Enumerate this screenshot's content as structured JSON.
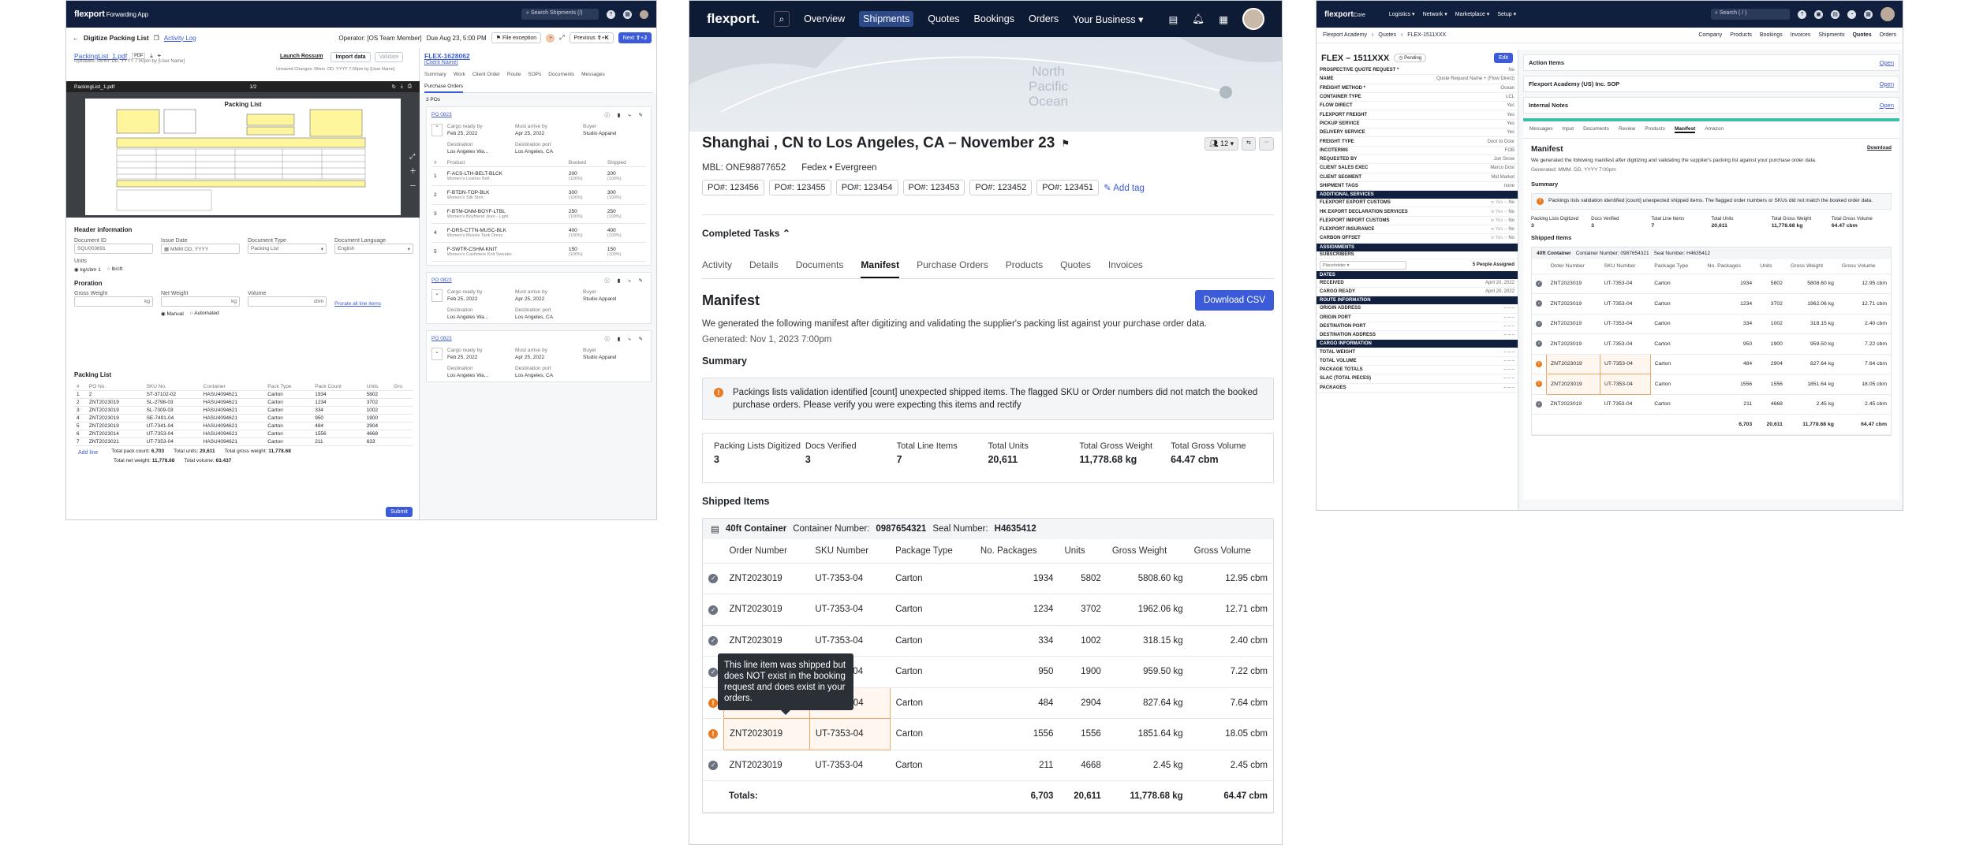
{
  "left": {
    "brand": "flexport",
    "brand_sub": "Forwarding App",
    "search": "Search Shipments (/)",
    "title": "Digitize Packing List",
    "activity_log": "Activity Log",
    "operator": "Operator: [OS Team Member]",
    "due": "Due Aug 23, 5:00 PM",
    "file_exception": "File exception",
    "previous": "Previous",
    "prev_key": "⇧",
    "prev_key2": "K",
    "next": "Next",
    "next_key": "⇧",
    "next_key2": "J",
    "file_name": "PackingList_1.pdf",
    "file_tag": "PDF",
    "launch": "Launch Rossum",
    "import": "Import data",
    "validate": "Validate",
    "uploaded": "Uploaded: Mmm. DD, YYYY 7:00pm by [User Name]",
    "unsaved": "Unsaved Changes: Mmm. DD, YYYY 7:00pm by [User Name]",
    "pdf_name": "PackingList_1.pdf",
    "pdf_pages": "1/2",
    "doc_heading": "Packing List",
    "header_info": "Header information",
    "doc_id_label": "Document ID",
    "doc_id": "SQU003691",
    "issue_date_label": "Issue Date",
    "issue_date": "MMM DD, YYYY",
    "doc_type_label": "Document Type",
    "doc_type": "Packing List",
    "doc_lang_label": "Document Language",
    "doc_lang": "English",
    "units_label": "Units",
    "unit1": "kg/cbm 1",
    "unit2": "lb/cft",
    "proration": "Proration",
    "gross_label": "Gross Weight",
    "gross_unit": "kg",
    "net_label": "Net Weight",
    "net_unit": "kg",
    "vol_label": "Volume",
    "vol_unit": "cbm",
    "prorate": "Prorate all line items",
    "manual": "Manual",
    "automated": "Automated",
    "packing_list": "Packing List",
    "pl_cols": [
      "#",
      "PO No.",
      "SKU No.",
      "Container",
      "Pack Type",
      "Pack Count",
      "Units",
      "Gro"
    ],
    "pl_rows": [
      [
        "1",
        "2",
        "ST-37102-02",
        "HASU4094621",
        "Carton",
        "1934",
        "5802"
      ],
      [
        "2",
        "ZNT2023019",
        "SL-2798-03",
        "HASU4094621",
        "Carton",
        "1234",
        "3702"
      ],
      [
        "3",
        "ZNT2023019",
        "SL-7309-03",
        "HASU4094621",
        "Carton",
        "334",
        "1002"
      ],
      [
        "4",
        "ZNT2023019",
        "SE-7491-04",
        "HASU4094621",
        "Carton",
        "950",
        "1900"
      ],
      [
        "5",
        "ZNT2023019",
        "UT-7341-04",
        "HASU4094621",
        "Carton",
        "484",
        "2904"
      ],
      [
        "6",
        "ZNT2023014",
        "UT-7353-04",
        "HASU4094621",
        "Carton",
        "1556",
        "4668"
      ],
      [
        "7",
        "ZNT2023021",
        "UT-7353-04",
        "HASU4094621",
        "Carton",
        "211",
        "633"
      ]
    ],
    "add_line": "Add line",
    "total_pack": "Total pack count:",
    "total_pack_v": "6,703",
    "total_units": "Total units:",
    "total_units_v": "20,611",
    "total_gross": "Total gross weight:",
    "total_gross_v": "11,778.68",
    "total_net": "Total net weight:",
    "total_net_v": "11,778.68",
    "total_vol": "Total volume:",
    "total_vol_v": "63.437",
    "submit": "Submit",
    "flex_id": "FLEX-1628062",
    "client_name": "[Client Name]",
    "rtabs": [
      "Summary",
      "Work",
      "Client Order",
      "Route",
      "SOPs",
      "Documents",
      "Messages"
    ],
    "rsub": "Purchase Orders",
    "po_count": "3 POs",
    "po1": "PO 0823",
    "po2": "PO 0823",
    "po3": "PO 0823",
    "cargo_ready": "Cargo ready by",
    "must_arrive": "Must arrive by",
    "buyer": "Buyer",
    "cargo_date": "Feb 25, 2022",
    "arrive_date": "Apr 25, 2022",
    "buyer_name": "Studio Apparel",
    "destination": "Destination",
    "dest_port": "Destination port",
    "dest_val": "Los Angeles Wa...",
    "port_val": "Los Angeles, CA",
    "po_cols": [
      "#",
      "Product",
      "Booked",
      "Shipped"
    ],
    "po_items": [
      [
        "1",
        "F-ACS-LTH-BELT-BLCK",
        "Women's Leather Belt",
        "200",
        "200"
      ],
      [
        "2",
        "F-BTDN-TOP-BLK",
        "Women's Silk Shirt",
        "300",
        "300"
      ],
      [
        "3",
        "F-BTM-DNM-BOYF-LTBL",
        "Women's Boyfriend Jean - Light",
        "250",
        "250"
      ],
      [
        "4",
        "F-DRS-CTTN-MUSC-BLK",
        "Women's Muscle Tank Dress",
        "400",
        "400"
      ],
      [
        "5",
        "F-SWTR-CSHM-KNIT",
        "Women's Cashmere Knit Sweater",
        "150",
        "150"
      ]
    ],
    "pct": "(100%)"
  },
  "mid": {
    "brand": "flexport.",
    "nav": [
      "Overview",
      "Shipments",
      "Quotes",
      "Bookings",
      "Orders",
      "Your Business"
    ],
    "map_labels": [
      "North",
      "Pacific",
      "Ocean"
    ],
    "title": "Shanghai , CN to Los Angeles, CA – November 23",
    "mbl": "MBL: ONE98877652",
    "carrier": "Fedex • Evergreen",
    "pos": [
      "PO#: 123456",
      "PO#: 123455",
      "PO#: 123454",
      "PO#: 123453",
      "PO#: 123452",
      "PO#: 123451"
    ],
    "add_tag": "Add tag",
    "tasks": "Completed Tasks",
    "tabs": [
      "Activity",
      "Details",
      "Documents",
      "Manifest",
      "Purchase Orders",
      "Products",
      "Quotes",
      "Invoices"
    ],
    "manifest": "Manifest",
    "download": "Download CSV",
    "desc": "We generated the following manifest after digitizing and validating the supplier's packing list against your purchase order data.",
    "generated": "Generated: Nov 1, 2023 7:00pm",
    "summary": "Summary",
    "alert": "Packings lists validation identified [count] unexpected shipped items. The flagged SKU or Order numbers did not match the booked purchase orders. Please verify you were expecting this items and rectify",
    "stats": [
      {
        "label": "Packing Lists Digitized",
        "value": "3"
      },
      {
        "label": "Docs Verified",
        "value": "3"
      },
      {
        "label": "Total Line Items",
        "value": "7"
      },
      {
        "label": "Total Units",
        "value": "20,611"
      },
      {
        "label": "Total Gross Weight",
        "value": "11,778.68 kg"
      },
      {
        "label": "Total Gross Volume",
        "value": "64.47 cbm"
      }
    ],
    "shipped": "Shipped Items",
    "container": "40ft Container",
    "container_no_label": "Container Number:",
    "container_no": "0987654321",
    "seal_label": "Seal Number:",
    "seal": "H4635412",
    "cols": [
      "Order Number",
      "SKU Number",
      "Package Type",
      "No. Packages",
      "Units",
      "Gross Weight",
      "Gross Volume"
    ],
    "rows": [
      [
        "ok",
        "ZNT2023019",
        "UT-7353-04",
        "Carton",
        "1934",
        "5802",
        "5808.60 kg",
        "12.95 cbm"
      ],
      [
        "ok",
        "ZNT2023019",
        "UT-7353-04",
        "Carton",
        "1234",
        "3702",
        "1962.06 kg",
        "12.71 cbm"
      ],
      [
        "ok",
        "ZNT2023019",
        "UT-7353-04",
        "Carton",
        "334",
        "1002",
        "318.15 kg",
        "2.40 cbm"
      ],
      [
        "ok",
        "ZNT2023019",
        "UT-7353-04",
        "Carton",
        "950",
        "1900",
        "959.50 kg",
        "7.22 cbm"
      ],
      [
        "warn",
        "ZNT2023019",
        "UT-7353-04",
        "Carton",
        "484",
        "2904",
        "827.64 kg",
        "7.64 cbm"
      ],
      [
        "warn",
        "ZNT2023019",
        "UT-7353-04",
        "Carton",
        "1556",
        "1556",
        "1851.64 kg",
        "18.05 cbm"
      ],
      [
        "ok",
        "ZNT2023019",
        "UT-7353-04",
        "Carton",
        "211",
        "4668",
        "2.45 kg",
        "2.45 cbm"
      ]
    ],
    "totals": "Totals:",
    "tot_pk": "6,703",
    "tot_units": "20,611",
    "tot_gw": "11,778.68 kg",
    "tot_gv": "64.47 cbm",
    "tooltip": "This line item was shipped but does NOT exist in the booking request and does exist in your orders."
  },
  "right": {
    "brand": "flexport",
    "brand_sub": "Core",
    "nav": [
      "Logistics",
      "Network",
      "Marketplace",
      "Setup"
    ],
    "search": "Search ( / )",
    "crumbs": [
      "Flexport Academy",
      "Quotes",
      "FLEX-1511XXX"
    ],
    "top_tabs": [
      "Company",
      "Products",
      "Bookings",
      "Invoices",
      "Shipments",
      "Quotes",
      "Orders"
    ],
    "flex": "FLEX – 1511XXX",
    "status": "Pending",
    "edit": "Edit",
    "fields": [
      [
        "Prospective Quote Request *",
        "No"
      ],
      [
        "Name",
        "Quote Request Name + (Flow Direct)"
      ],
      [
        "Freight Method *",
        "Ocean"
      ],
      [
        "Container Type",
        "LCL"
      ],
      [
        "Flow Direct",
        "Yes"
      ],
      [
        "Flexport Freight",
        "Yes"
      ],
      [
        "Pickup Service",
        "Yes"
      ],
      [
        "Delivery Service",
        "Yes"
      ],
      [
        "Freight Type",
        "Door to Door"
      ],
      [
        "Incoterms",
        "FOB"
      ],
      [
        "Requested By",
        "Jon Snow"
      ],
      [
        "Client Sales Exec",
        "Marco Dost"
      ],
      [
        "Client Segment",
        "Mid Market"
      ],
      [
        "Shipment Tags",
        "none"
      ]
    ],
    "sec_add": "Additional Services",
    "add_fields": [
      "Flexport Export Customs",
      "HK Export Declaration Services",
      "Flexport Import Customs",
      "Flexport Insurance",
      "Carbon Offset"
    ],
    "yes": "Yes",
    "no": "No",
    "sec_assign": "Assignments",
    "subscribers": "Subscribers",
    "placeholder": "Placeholder",
    "assigned": "5 People Assigned",
    "sec_dates": "Dates",
    "received": "Received",
    "received_v": "April 20, 2022",
    "cargo_ready": "Cargo Ready",
    "cargo_ready_v": "April 20, 2022",
    "sec_route": "Route Information",
    "route": [
      "Origin Address",
      "Origin Port",
      "Destination Port",
      "Destination Address"
    ],
    "sec_cargo": "Cargo Information",
    "cargo": [
      "Total Weight",
      "Total Volume",
      "Package Totals",
      "SLAC (Total Pieces)",
      "Packages"
    ],
    "dash": "– – –",
    "action_items": "Action Items",
    "open": "Open",
    "sop": "Flexport Academy (US) Inc. SOP",
    "notes": "Internal Notes",
    "tabs": [
      "Messages",
      "Input",
      "Documents",
      "Review",
      "Products",
      "Manifest",
      "Amazon"
    ],
    "manifest": "Manifest",
    "download": "Download",
    "desc": "We generated the following manifest after digitizing and validating the supplier's packing list against your purchase order data.",
    "generated": "Generated: MMM. DD, YYYY 7:00pm",
    "summary": "Summary",
    "alert": "Packings lists validation identified [count] unexpected shipped items. The flagged order numbers or SKUs did not match the booked order data.",
    "stats": [
      {
        "label": "Packing Lists Digitized",
        "value": "3"
      },
      {
        "label": "Docs Verified",
        "value": "3"
      },
      {
        "label": "Total Line Items",
        "value": "7"
      },
      {
        "label": "Total Units",
        "value": "20,611"
      },
      {
        "label": "Total Gross Weight",
        "value": "11,778.68 kg"
      },
      {
        "label": "Total Gross Volume",
        "value": "64.47 cbm"
      }
    ],
    "shipped": "Shipped Items",
    "container": "40ft Container",
    "container_no": "Container Number: 0987654321",
    "seal": "Seal Number: H4635412",
    "cols": [
      "Order Number",
      "SKU Number",
      "Package Type",
      "No. Packages",
      "Units",
      "Gross Weight",
      "Gross Volume"
    ],
    "totals_pk": "6,703",
    "totals_units": "20,611",
    "totals_gw": "11,778.68 kg",
    "totals_gv": "64.47 cbm"
  },
  "colors": {
    "navy": "#0d1b35",
    "accent": "#3c5bd8",
    "warn": "#ea7a1f",
    "teal": "#3bbfa6"
  }
}
